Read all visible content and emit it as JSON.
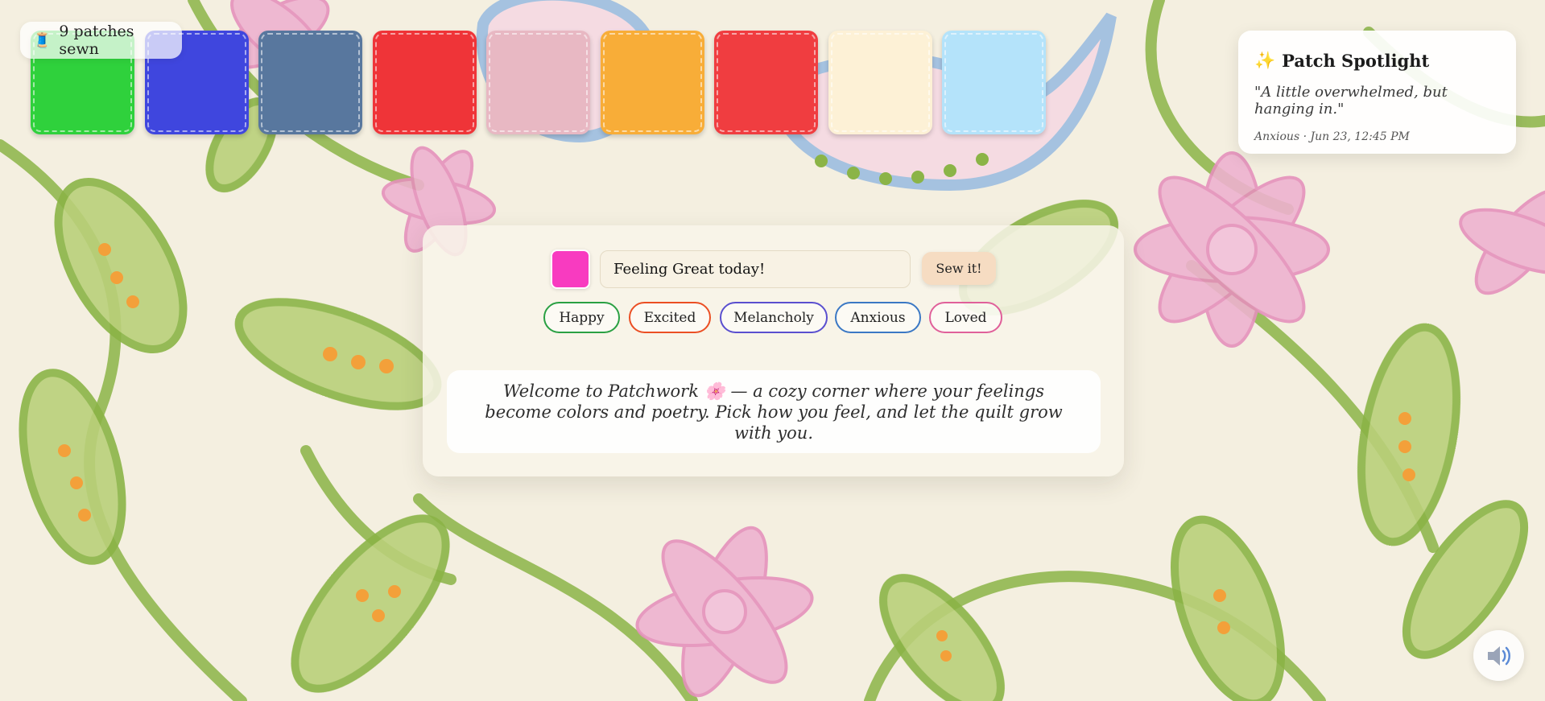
{
  "counter": {
    "icon": "thread-spool-icon",
    "glyph": "🧵",
    "text": "9 patches sewn"
  },
  "quilt": {
    "patches": [
      {
        "color": "#2fd13c"
      },
      {
        "color": "#3f46de"
      },
      {
        "color": "#58779e"
      },
      {
        "color": "#ef3438"
      },
      {
        "color": "#e8b8c3"
      },
      {
        "color": "#f8ad38"
      },
      {
        "color": "#f03d40"
      },
      {
        "color": "#fdf1d6"
      },
      {
        "color": "#b4e3fa"
      }
    ]
  },
  "spotlight": {
    "icon": "sparkles-icon",
    "glyph": "✨",
    "title": "Patch Spotlight",
    "quote": "\"A little overwhelmed, but hanging in.\"",
    "meta": "Anxious · Jun 23, 12:45 PM"
  },
  "composer": {
    "selected_color": "#f83bc0",
    "input_value": "Feeling Great today!",
    "sew_label": "Sew it!",
    "moods": [
      {
        "label": "Happy",
        "color": "#2aa043"
      },
      {
        "label": "Excited",
        "color": "#eb4f24"
      },
      {
        "label": "Melancholy",
        "color": "#5a4fcf"
      },
      {
        "label": "Anxious",
        "color": "#3b78c4"
      },
      {
        "label": "Loved",
        "color": "#e0609a"
      }
    ],
    "welcome": "Welcome to Patchwork 🌸 — a cozy corner where your feelings become colors and poetry. Pick how you feel, and let the quilt grow with you."
  },
  "sound": {
    "icon": "speaker-volume-icon"
  },
  "colors": {
    "background": "#f4efe0",
    "vine_green": "#8bb447",
    "flower_pink": "#eeb1d0",
    "paisley_blue": "#9dbde0",
    "seed_orange": "#f3a03a"
  }
}
